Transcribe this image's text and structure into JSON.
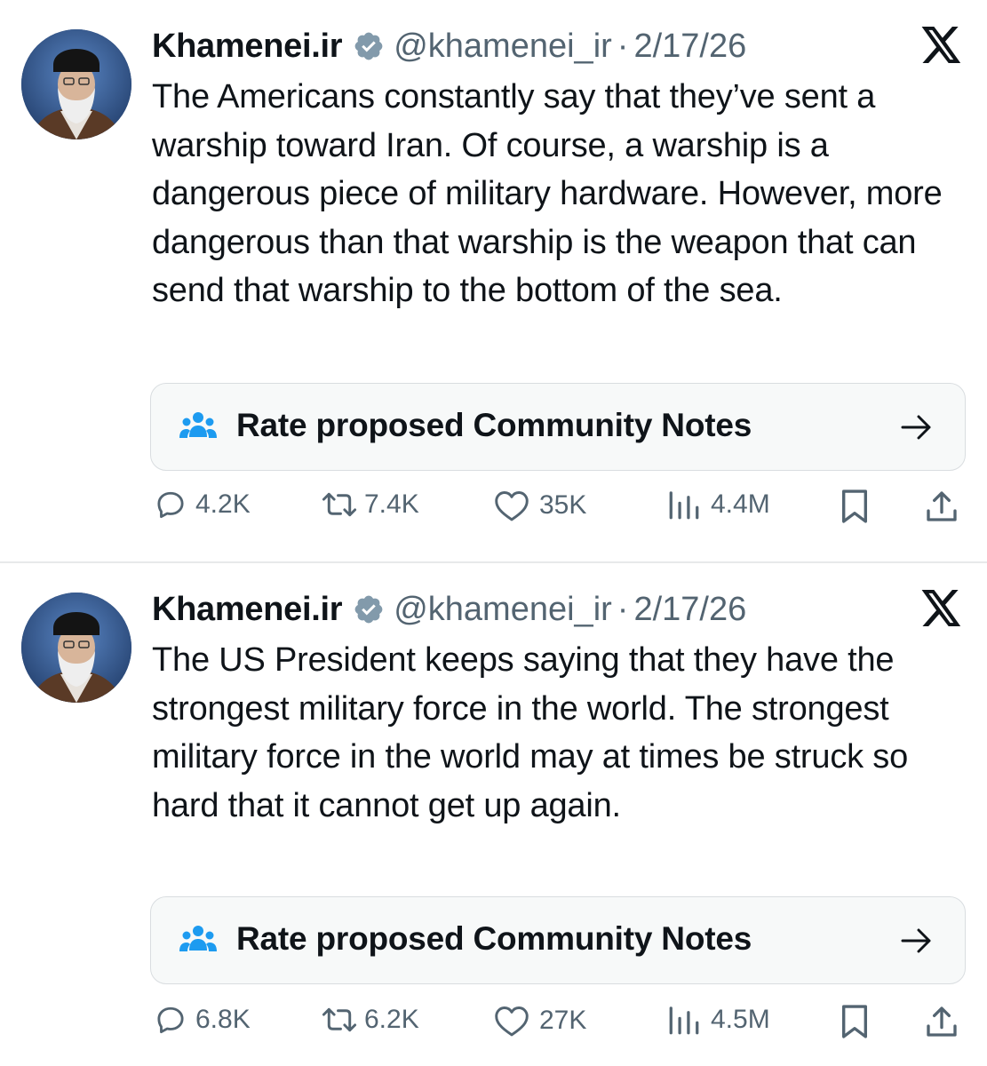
{
  "tweets": [
    {
      "author": {
        "name": "Khamenei.ir",
        "handle": "@khamenei_ir",
        "separator": "·",
        "date": "2/17/26",
        "verified": true
      },
      "text": "The Americans constantly say that they’ve sent a warship toward Iran. Of course, a warship is a dangerous piece of military hardware. However, more dangerous than that warship is the weapon that can send that warship to the bottom of the sea.",
      "community_notes_label": "Rate proposed Community Notes",
      "stats": {
        "replies": "4.2K",
        "reposts": "7.4K",
        "likes": "35K",
        "views": "4.4M"
      }
    },
    {
      "author": {
        "name": "Khamenei.ir",
        "handle": "@khamenei_ir",
        "separator": "·",
        "date": "2/17/26",
        "verified": true
      },
      "text": "The US President keeps saying that they have the strongest military force in the world. The strongest military force in the world may at times be struck so hard that it cannot get up again.",
      "community_notes_label": "Rate proposed Community Notes",
      "stats": {
        "replies": "6.8K",
        "reposts": "6.2K",
        "likes": "27K",
        "views": "4.5M"
      }
    }
  ],
  "colors": {
    "text": "#0f1419",
    "secondary": "#536471",
    "community_notes_icon": "#1d9bf0",
    "verified_badge": "#829aab",
    "divider": "#e7e9ea"
  },
  "icons": [
    "x-logo-icon",
    "verified-badge-icon",
    "community-notes-icon",
    "arrow-right-icon",
    "reply-icon",
    "repost-icon",
    "like-icon",
    "views-icon",
    "bookmark-icon",
    "share-icon"
  ]
}
